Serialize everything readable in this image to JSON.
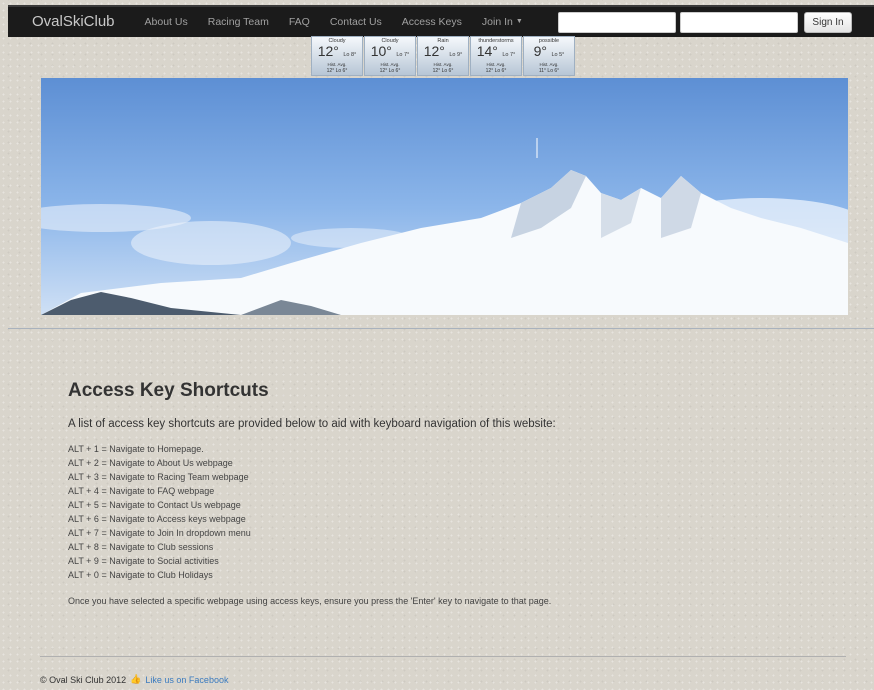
{
  "brand": "OvalSkiClub",
  "nav": {
    "about": "About Us",
    "racing": "Racing Team",
    "faq": "FAQ",
    "contact": "Contact Us",
    "access": "Access Keys",
    "join": "Join In"
  },
  "signin": {
    "button": "Sign In"
  },
  "weather": [
    {
      "cond": "Cloudy",
      "hi": "12°",
      "lo": "Lo 8°",
      "avg_label": "Hist. Avg.",
      "avg": "12° Lo 6°"
    },
    {
      "cond": "Cloudy",
      "hi": "10°",
      "lo": "Lo 7°",
      "avg_label": "Hist. Avg.",
      "avg": "12° Lo 6°"
    },
    {
      "cond": "Rain",
      "hi": "12°",
      "lo": "Lo 9°",
      "avg_label": "Hist. Avg.",
      "avg": "12° Lo 6°"
    },
    {
      "cond": "thunderstorms",
      "hi": "14°",
      "lo": "Lo 7°",
      "avg_label": "Hist. Avg.",
      "avg": "12° Lo 6°"
    },
    {
      "cond": "possible",
      "hi": "9°",
      "lo": "Lo 5°",
      "avg_label": "Hist. Avg.",
      "avg": "11° Lo 6°"
    }
  ],
  "content": {
    "title": "Access Key Shortcuts",
    "lead": "A list of access key shortcuts are provided below to aid with keyboard navigation of this website:",
    "shortcuts": [
      "ALT + 1 = Navigate to Homepage.",
      "ALT + 2 = Navigate to About Us webpage",
      "ALT + 3 = Navigate to Racing Team webpage",
      "ALT + 4 = Navigate to FAQ webpage",
      "ALT + 5 = Navigate to Contact Us webpage",
      "ALT + 6 = Navigate to Access keys webpage",
      "ALT + 7 = Navigate to Join In dropdown menu",
      "ALT + 8 = Navigate to Club sessions",
      "ALT + 9 = Navigate to Social activities",
      "ALT + 0 = Navigate to Club Holidays"
    ],
    "note": "Once you have selected a specific webpage using access keys, ensure you press the 'Enter' key to navigate to that page."
  },
  "footer": {
    "copyright": "© Oval Ski Club 2012",
    "facebook": "Like us on Facebook"
  },
  "colors": {
    "navbar": "#1b1b1b",
    "link": "#3b7bbf",
    "background": "#d9d5cc"
  }
}
